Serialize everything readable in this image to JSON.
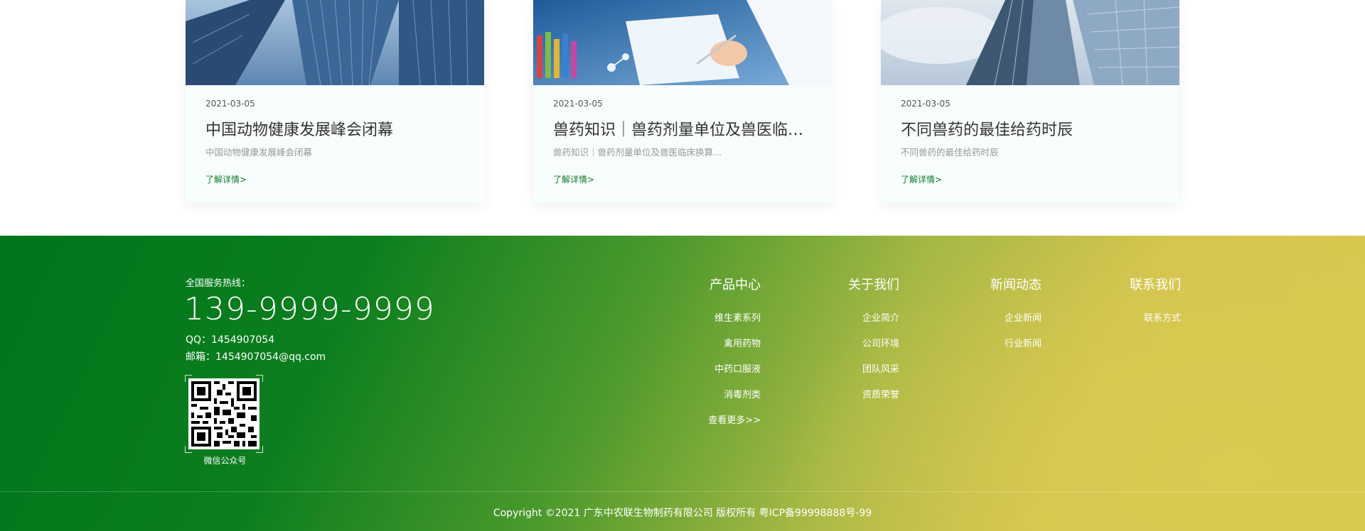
{
  "news": {
    "cards": [
      {
        "date": "2021-03-05",
        "title": "中国动物健康发展峰会闭幕",
        "desc": "中国动物健康发展峰会闭幕",
        "more": "了解详情>",
        "image_icon": "skyscraper-photo"
      },
      {
        "date": "2021-03-05",
        "title": "兽药知识｜兽药剂量单位及兽医临床...",
        "desc": "兽药知识｜兽药剂量单位及兽医临床换算...",
        "more": "了解详情>",
        "image_icon": "lab-clipboard-photo"
      },
      {
        "date": "2021-03-05",
        "title": "不同兽药的最佳给药时辰",
        "desc": "不同兽药的最佳给药时辰",
        "more": "了解详情>",
        "image_icon": "glass-tower-photo"
      }
    ]
  },
  "footer": {
    "hotline_label": "全国服务热线：",
    "hotline": "139-9999-9999",
    "qq": "QQ：1454907054",
    "email": "邮箱：1454907054@qq.com",
    "qr_caption": "微信公众号",
    "columns": [
      {
        "title": "产品中心",
        "items": [
          "维生素系列",
          "禽用药物",
          "中药口服液",
          "消毒剂类",
          "查看更多>>"
        ]
      },
      {
        "title": "关于我们",
        "items": [
          "企业简介",
          "公司环境",
          "团队风采",
          "资质荣誉"
        ]
      },
      {
        "title": "新闻动态",
        "items": [
          "企业新闻",
          "行业新闻"
        ]
      },
      {
        "title": "联系我们",
        "items": [
          "联系方式"
        ]
      }
    ],
    "copyright": "Copyright ©2021 广东中农联生物制药有限公司 版权所有    粤ICP备99998888号-99"
  },
  "colors": {
    "accent": "#0f7a2a",
    "footer_start": "#00751a",
    "footer_end": "#d9c84f"
  }
}
